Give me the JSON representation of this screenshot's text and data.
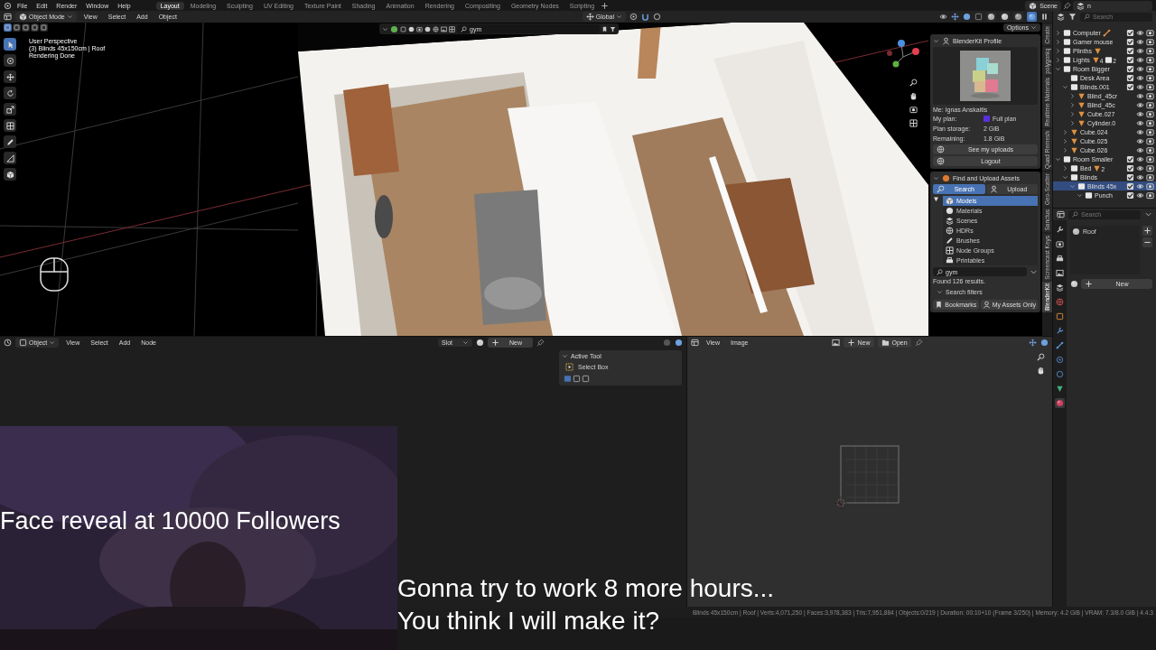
{
  "topbar": {
    "menus": [
      "File",
      "Edit",
      "Render",
      "Window",
      "Help"
    ],
    "workspaces": [
      {
        "label": "Layout",
        "selected": true
      },
      {
        "label": "Modeling",
        "selected": false
      },
      {
        "label": "Sculpting",
        "selected": false
      },
      {
        "label": "UV Editing",
        "selected": false
      },
      {
        "label": "Texture Paint",
        "selected": false
      },
      {
        "label": "Shading",
        "selected": false
      },
      {
        "label": "Animation",
        "selected": false
      },
      {
        "label": "Rendering",
        "selected": false
      },
      {
        "label": "Compositing",
        "selected": false
      },
      {
        "label": "Geometry Nodes",
        "selected": false
      },
      {
        "label": "Scripting",
        "selected": false
      }
    ],
    "scene": "Scene",
    "view_layer": "n"
  },
  "viewport": {
    "mode": "Object Mode",
    "menus": [
      "View",
      "Select",
      "Add",
      "Object"
    ],
    "orientation": "Global",
    "search": "gym",
    "options": "Options",
    "shading_modes": [
      {
        "selected": false
      },
      {
        "selected": false
      },
      {
        "selected": false
      },
      {
        "selected": true
      }
    ],
    "tools": [
      {
        "selected": true
      },
      {
        "selected": false
      },
      {
        "selected": false
      },
      {
        "selected": false
      },
      {
        "selected": false
      },
      {
        "selected": false
      },
      {
        "selected": false
      },
      {
        "selected": false
      },
      {
        "selected": false
      }
    ],
    "overlay_lines": [
      "User Perspective",
      "(3) Blinds 45x150cm | Roof",
      "Rendering Done"
    ]
  },
  "n_panel": {
    "tabs": [
      {
        "label": "Create",
        "selected": false
      },
      {
        "label": "polygoniq",
        "selected": false
      },
      {
        "label": "Realtime Materials",
        "selected": false
      },
      {
        "label": "Quad Remesh",
        "selected": false
      },
      {
        "label": "Geo-Scatter",
        "selected": false
      },
      {
        "label": "Sanctus",
        "selected": false
      },
      {
        "label": "Screencast Keys",
        "selected": false
      },
      {
        "label": "BlenderKit",
        "selected": true
      }
    ],
    "profile": {
      "title": "BlenderKit Profile",
      "user": "Me: Ignas Anskaitis",
      "rows": [
        {
          "label": "My plan:",
          "value": "Full plan"
        },
        {
          "label": "Plan storage:",
          "value": "2 GiB"
        },
        {
          "label": "Remaining:",
          "value": "1.8 GiB"
        }
      ],
      "buttons": [
        "See my uploads",
        "Logout"
      ]
    },
    "assets": {
      "title": "Find and Upload Assets",
      "tabs": [
        {
          "label": "Search",
          "selected": true
        },
        {
          "label": "Upload",
          "selected": false
        }
      ],
      "categories": [
        {
          "label": "Models",
          "selected": true
        },
        {
          "label": "Materials",
          "selected": false
        },
        {
          "label": "Scenes",
          "selected": false
        },
        {
          "label": "HDRs",
          "selected": false
        },
        {
          "label": "Brushes",
          "selected": false
        },
        {
          "label": "Node Groups",
          "selected": false
        },
        {
          "label": "Printables",
          "selected": false
        }
      ],
      "search": "gym",
      "results": "Found 126 results.",
      "filters": "Search filters",
      "buttons": [
        "Bookmarks",
        "My Assets Only"
      ]
    }
  },
  "outliner": {
    "search_placeholder": "Search",
    "items": [
      {
        "name": "Computer",
        "kind": "collection",
        "expanded": false,
        "checked": true,
        "selected": false,
        "badges": [
          {
            "kind": "armature"
          }
        ]
      },
      {
        "name": "Gamer mouse",
        "kind": "collection",
        "expanded": false,
        "checked": true,
        "selected": false
      },
      {
        "name": "Plinths",
        "kind": "collection",
        "expanded": false,
        "checked": true,
        "selected": false,
        "badges": [
          {
            "kind": "mesh"
          }
        ]
      },
      {
        "name": "Lights",
        "kind": "collection",
        "expanded": false,
        "checked": true,
        "selected": false,
        "badges": [
          {
            "kind": "mesh",
            "count": "4"
          },
          {
            "kind": "collection",
            "count": "2"
          }
        ]
      },
      {
        "name": "Room Bigger",
        "kind": "collection",
        "expanded": true,
        "checked": true,
        "selected": false,
        "children": [
          {
            "name": "Desk Area",
            "kind": "collection",
            "checked": true,
            "selected": false
          },
          {
            "name": "Blinds.001",
            "kind": "collection",
            "expanded": true,
            "checked": true,
            "selected": false,
            "children": [
              {
                "name": "Blind_45cr",
                "kind": "object",
                "expanded": false,
                "selected": false
              },
              {
                "name": "Blind_45c",
                "kind": "object",
                "expanded": false,
                "selected": false
              },
              {
                "name": "Cube.027",
                "kind": "object",
                "expanded": false,
                "selected": false
              },
              {
                "name": "Cylinder.0",
                "kind": "object",
                "expanded": false,
                "selected": false
              }
            ]
          },
          {
            "name": "Cube.024",
            "kind": "object",
            "expanded": false,
            "selected": false
          },
          {
            "name": "Cube.025",
            "kind": "object",
            "expanded": false,
            "selected": false
          },
          {
            "name": "Cube.026",
            "kind": "object",
            "expanded": false,
            "selected": false
          }
        ]
      },
      {
        "name": "Room Smaller",
        "kind": "collection",
        "expanded": true,
        "checked": true,
        "selected": false,
        "children": [
          {
            "name": "Bed",
            "kind": "collection",
            "expanded": false,
            "checked": true,
            "selected": false,
            "badges": [
              {
                "kind": "mesh",
                "count": "2"
              }
            ]
          },
          {
            "name": "Blinds",
            "kind": "collection",
            "expanded": true,
            "checked": true,
            "selected": false,
            "children": [
              {
                "name": "Blinds 45x",
                "kind": "collection",
                "expanded": true,
                "checked": true,
                "selected": true,
                "children": [
                  {
                    "name": "Punch",
                    "kind": "collection",
                    "expanded": true,
                    "checked": true,
                    "selected": false
                  }
                ]
              }
            ]
          }
        ]
      }
    ]
  },
  "properties": {
    "search_placeholder": "Search",
    "slot": "Roof",
    "new_button": "New",
    "tabs": [
      {
        "selected": false
      },
      {
        "selected": false
      },
      {
        "selected": false
      },
      {
        "selected": false
      },
      {
        "selected": false
      },
      {
        "selected": false
      },
      {
        "selected": false
      },
      {
        "selected": false
      },
      {
        "selected": false
      },
      {
        "selected": false
      },
      {
        "selected": false
      },
      {
        "selected": false
      },
      {
        "selected": true
      }
    ]
  },
  "shader_editor": {
    "object": "Object",
    "menus": [
      "View",
      "Select",
      "Add",
      "Node"
    ],
    "slot": "Slot",
    "new_button": "New",
    "active_tool": {
      "title": "Active Tool",
      "tool": "Select Box"
    }
  },
  "image_editor": {
    "menus": [
      "View",
      "Image"
    ],
    "buttons": [
      "New",
      "Open"
    ]
  },
  "status_bar": "Blinds 45x150cm | Roof | Verts:4,071,250 | Faces:3,978,383 | Tris:7,951,884 | Objects:0/219 | Duration: 00:10+10 (Frame 3/250) | Memory: 4.2 GiB | VRAM: 7.3/8.0 GiB | 4.4.3",
  "webcam": {
    "caption": "Face reveal at 10000 Followers"
  },
  "subtitles": [
    "Gonna try to work 8 more hours...",
    "You think I will make it?"
  ]
}
